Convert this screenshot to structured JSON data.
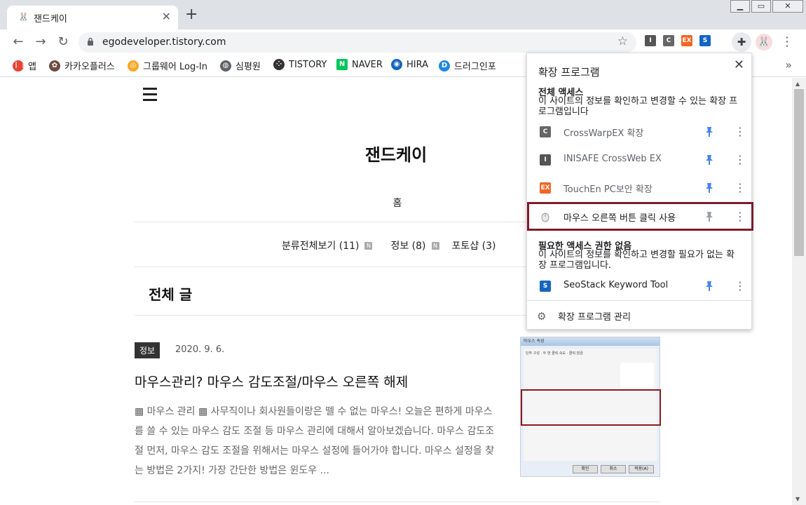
{
  "tab": {
    "title": "잰드케이",
    "favicon": "🐰",
    "close": "✕"
  },
  "new_tab": "+",
  "window": {
    "minimize": "▁",
    "maximize": "▭",
    "close": "✕"
  },
  "toolbar": {
    "back": "←",
    "forward": "→",
    "reload": "↻",
    "url": "egodeveloper.tistory.com",
    "star": "☆",
    "menu": "⋮",
    "puzzle": "✚",
    "profile": "🐰"
  },
  "toolbar_ext": [
    {
      "label": "I",
      "color": "#555555"
    },
    {
      "label": "C",
      "color": "#666666"
    },
    {
      "label": "EX",
      "color": "#f26522"
    },
    {
      "label": "S",
      "color": "#1565c0"
    }
  ],
  "bookmarks": [
    {
      "label": "앱",
      "icon_color": "#ea4335",
      "glyph": "⋮⋮"
    },
    {
      "label": "카카오플러스",
      "icon_color": "#6d4c41",
      "glyph": "✿"
    },
    {
      "label": "그룹웨어 Log-In",
      "icon_color": "#f9a825",
      "glyph": "◎"
    },
    {
      "label": "심평원",
      "icon_color": "#5f6368",
      "glyph": "◍"
    },
    {
      "label": "TISTORY",
      "icon_color": "#333333",
      "glyph": "⁘"
    },
    {
      "label": "NAVER",
      "icon_color": "#03c75a",
      "glyph": "N"
    },
    {
      "label": "HIRA",
      "icon_color": "#1565c0",
      "glyph": "◉"
    },
    {
      "label": "드러그인포",
      "icon_color": "#1e88e5",
      "glyph": "D"
    }
  ],
  "bookmarks_more": "»",
  "blog": {
    "title": "잰드케이",
    "home": "홈",
    "categories": [
      {
        "label": "분류전체보기 (11)",
        "badge": "N"
      },
      {
        "label": "정보 (8)",
        "badge": "N"
      },
      {
        "label": "포토샵 (3)",
        "badge": ""
      }
    ],
    "section_title": "전체 글"
  },
  "post": {
    "category": "정보",
    "date": "2020. 9. 6.",
    "title": "마우스관리? 마우스 감도조절/마우스 오른쪽 해제",
    "excerpt": "▩ 마우스 관리 ▩ 사무직이나 회사원들이랑은 뗄 수 없는 마우스! 오늘은 편하게 마우스를 쓸 수 있는 마우스 감도 조절 등 마우스 관리에 대해서 알아보겠습니다. 마우스 감도조절 먼저, 마우스 감도 조절을 위해서는 마우스 설정에 들어가야 합니다. 마우스 설정을 찾는 방법은 2가지! 가장 간단한 방법은 윈도우 ...",
    "thumb": {
      "window_title": "마우스 속성",
      "text": "단추 구성 · 두 번 클릭 속도 · 클릭 잠금",
      "ok": "확인",
      "cancel": "취소",
      "apply": "적용(A)"
    }
  },
  "popup": {
    "title": "확장 프로그램",
    "close": "✕",
    "full_access_head": "전체 액세스",
    "full_access_desc": "이 사이트의 정보를 확인하고 변경할 수 있는 확장 프로그램입니다",
    "full_access": [
      {
        "name": "CrossWarpEX 확장",
        "icon_label": "C",
        "icon_color": "#666666",
        "pinned": true
      },
      {
        "name": "INISAFE CrossWeb EX",
        "icon_label": "I",
        "icon_color": "#555555",
        "pinned": true
      },
      {
        "name": "TouchEn PC보안 확장",
        "icon_label": "EX",
        "icon_color": "#f26522",
        "pinned": true
      },
      {
        "name": "마우스 오른쪽 버튼 클릭 사용",
        "icon_label": "",
        "icon_color": "#e0e0e0",
        "pinned": false
      }
    ],
    "no_access_head": "필요한 액세스 권한 없음",
    "no_access_desc": "이 사이트의 정보를 확인하고 변경할 필요가 없는 확장 프로그램입니다.",
    "no_access": [
      {
        "name": "SeoStack Keyword Tool",
        "icon_label": "S",
        "icon_color": "#1565c0",
        "pinned": true
      }
    ],
    "manage": "확장 프로그램 관리"
  },
  "colors": {
    "pin_active": "#4285f4",
    "pin_inactive": "#9aa0a6",
    "highlight": "#7d1b2c"
  }
}
